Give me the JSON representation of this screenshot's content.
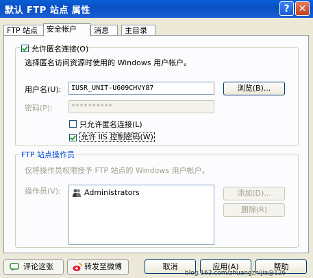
{
  "window": {
    "title": "默认 FTP 站点 属性"
  },
  "titlebar": {
    "help_label": "?",
    "close_label": "✕"
  },
  "tabs": [
    {
      "label": "FTP 站点"
    },
    {
      "label": "安全帐户"
    },
    {
      "label": "消息"
    },
    {
      "label": "主目录"
    }
  ],
  "anonymous": {
    "allow_label": "允许匿名连接(O)",
    "allow_checked": true,
    "description": "选择匿名访问资源时使用的 Windows 用户帐户。",
    "username_label": "用户名(U):",
    "username_value": "IUSR_UNIT-U609CHVY87",
    "browse_label": "浏览(B)...",
    "password_label": "密码(P):",
    "password_value": "**********",
    "only_anon_label": "只允许匿名连接(L)",
    "only_anon_checked": false,
    "iis_pwd_label": "允许 IIS 控制密码(W)",
    "iis_pwd_checked": true
  },
  "operators": {
    "group_title": "FTP 站点操作员",
    "description": "仅将操作员权限授予 FTP 站点的 Windows 用户帐户。",
    "operators_label": "操作员(V):",
    "items": [
      {
        "name": "Administrators",
        "icon": "group-icon"
      }
    ],
    "add_label": "添加(D)...",
    "remove_label": "删除(R)"
  },
  "footer": {
    "comment_label": "评论这张",
    "forward_label": "转发至微博",
    "cancel_label": "取消",
    "apply_label": "应用(A)",
    "help_label": "帮助"
  },
  "watermark": {
    "text": "blog.163.com/zhuangzhijia@126"
  }
}
